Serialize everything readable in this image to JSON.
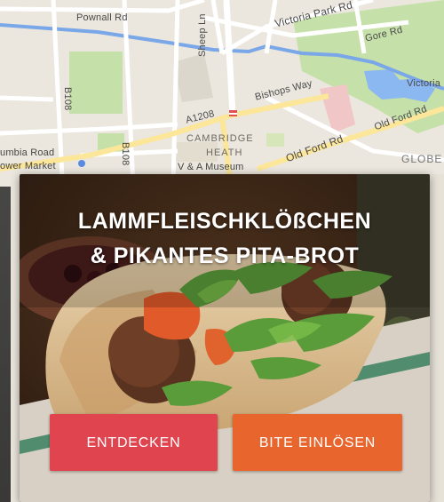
{
  "map": {
    "labels": {
      "pownall_rd": "Pownall Rd",
      "victoria_park_rd": "Victoria Park Rd",
      "gore_rd": "Gore Rd",
      "victoria": "Victoria",
      "sheep_ln": "Sheep Ln",
      "bishops_way": "Bishops Way",
      "a1208": "A1208",
      "b108": "B108",
      "b108_2": "B108",
      "cambridge_heath_1": "CAMBRIDGE",
      "cambridge_heath_2": "HEATH",
      "columbia_road_1": "umbia Road",
      "columbia_road_2": "ower Market",
      "old_ford_rd_1": "Old Ford Rd",
      "old_ford_rd_2": "Old Ford Rd",
      "va_museum": "V & A Museum",
      "globe": "GLOBE"
    }
  },
  "promo": {
    "headline_line1": "LAMMFLEISCHKLÖßCHEN",
    "headline_line2": "& PIKANTES PITA-BROT",
    "discover_label": "ENTDECKEN",
    "redeem_label": "BITE EINLÖSEN",
    "discover_color": "#e0444e",
    "redeem_color": "#e8662e"
  }
}
